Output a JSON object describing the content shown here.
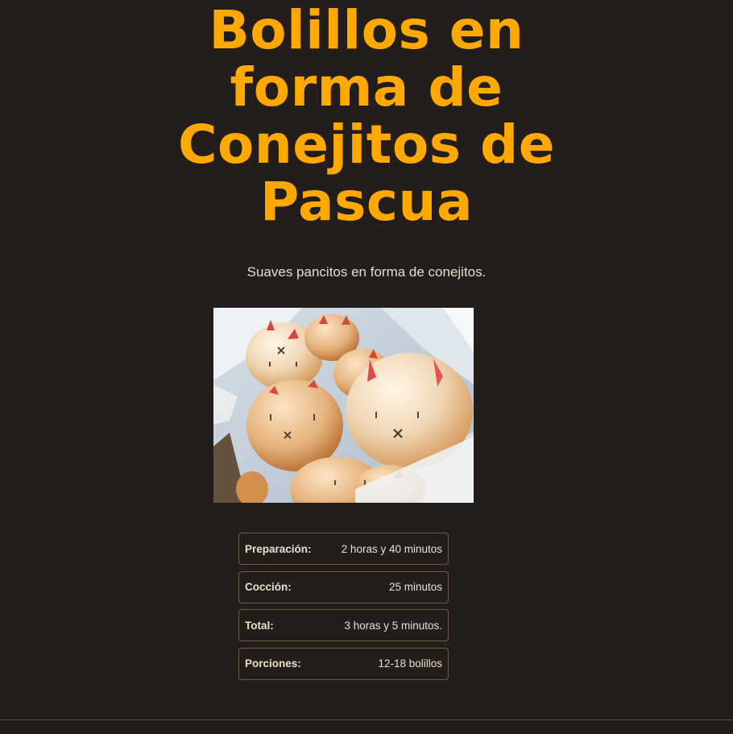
{
  "recipe": {
    "title": "Bolillos en forma de Conejitos de Pascua",
    "subtitle": "Suaves pancitos en forma de conejitos."
  },
  "details": [
    {
      "label": "Preparación:",
      "value": "2 horas y 40 minutos"
    },
    {
      "label": "Cocción:",
      "value": "25 minutos"
    },
    {
      "label": "Total:",
      "value": "3 horas y 5 minutos."
    },
    {
      "label": "Porciones:",
      "value": "12-18 bolillos"
    }
  ],
  "colors": {
    "background": "#231e1c",
    "title": "#ffa800",
    "text": "#e6dccb",
    "border": "#6f5a4a"
  }
}
